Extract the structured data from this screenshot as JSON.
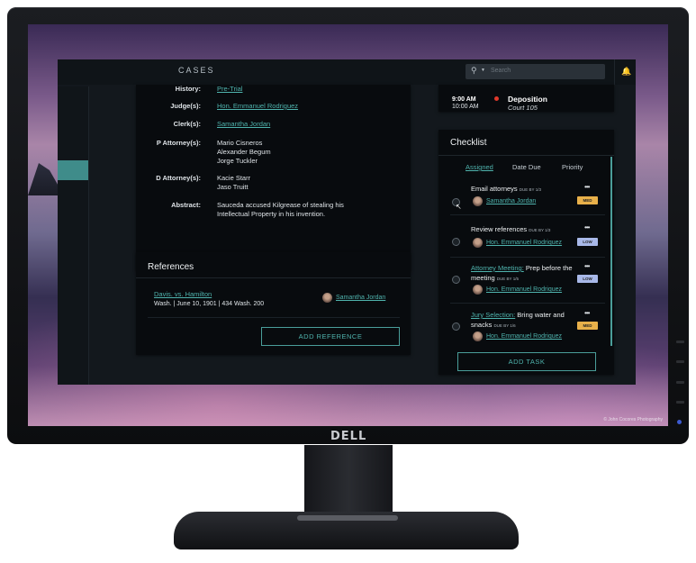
{
  "app": {
    "section_title": "CASES"
  },
  "search": {
    "placeholder": "Search"
  },
  "case_details": {
    "rows": [
      {
        "label": "History:",
        "value": "Pre-Trial"
      },
      {
        "label": "Judge(s):",
        "value": "Hon. Emmanuel Rodriguez"
      },
      {
        "label": "Clerk(s):",
        "value": "Samantha Jordan"
      },
      {
        "label": "P Attorney(s):",
        "values": [
          "Mario Cisneros",
          "Alexander Begum",
          "Jorge Tuckler"
        ]
      },
      {
        "label": "D Attorney(s):",
        "values": [
          "Kacie Starr",
          "Jaso Truitt"
        ]
      },
      {
        "label": "Abstract:",
        "values": [
          "Sauceda accused Kilgrease of stealing his",
          "Intellectual Property in his invention."
        ]
      }
    ]
  },
  "references": {
    "title": "References",
    "items": [
      {
        "case": "Davis. vs. Hamilton",
        "citation": "Wash. | June 10, 1901 | 434 Wash. 200",
        "author": "Samantha Jordan"
      }
    ],
    "add_button": "ADD REFERENCE"
  },
  "schedule": {
    "start_time": "9:00 AM",
    "end_time": "10:00 AM",
    "event": "Deposition",
    "location": "Court 105",
    "status_color": "#e0392b"
  },
  "checklist": {
    "title": "Checklist",
    "tabs": [
      "Assigned",
      "Date Due",
      "Priority"
    ],
    "active_tab": "Assigned",
    "tasks": [
      {
        "link": "",
        "title": "Email attorneys",
        "due": "DUE BY 1/3",
        "assignee": "Samantha Jordan",
        "priority": "MED",
        "priority_color": "#e8b04a"
      },
      {
        "link": "",
        "title": "Review references",
        "due": "DUE BY 1/3",
        "assignee": "Hon. Emmanuel Rodriquez",
        "priority": "LOW",
        "priority_color": "#a8b8e8"
      },
      {
        "link": "Attorney Meeting:",
        "title": " Prep before the meeting",
        "due": "DUE BY 1/5",
        "assignee": "Hon. Emmanuel Rodriquez",
        "priority": "LOW",
        "priority_color": "#a8b8e8"
      },
      {
        "link": "Jury Selection:",
        "title": " Bring water and snacks",
        "due": "DUE BY 1/6",
        "assignee": "Hon. Emmanuel Rodriquez",
        "priority": "MED",
        "priority_color": "#e8b04a"
      }
    ],
    "more_label": "•••",
    "add_button": "ADD TASK"
  },
  "monitor": {
    "brand": "DELL",
    "photo_credit": "© John Cocores Photography"
  },
  "icons": {
    "search": "search-icon",
    "bell": "bell-icon"
  }
}
